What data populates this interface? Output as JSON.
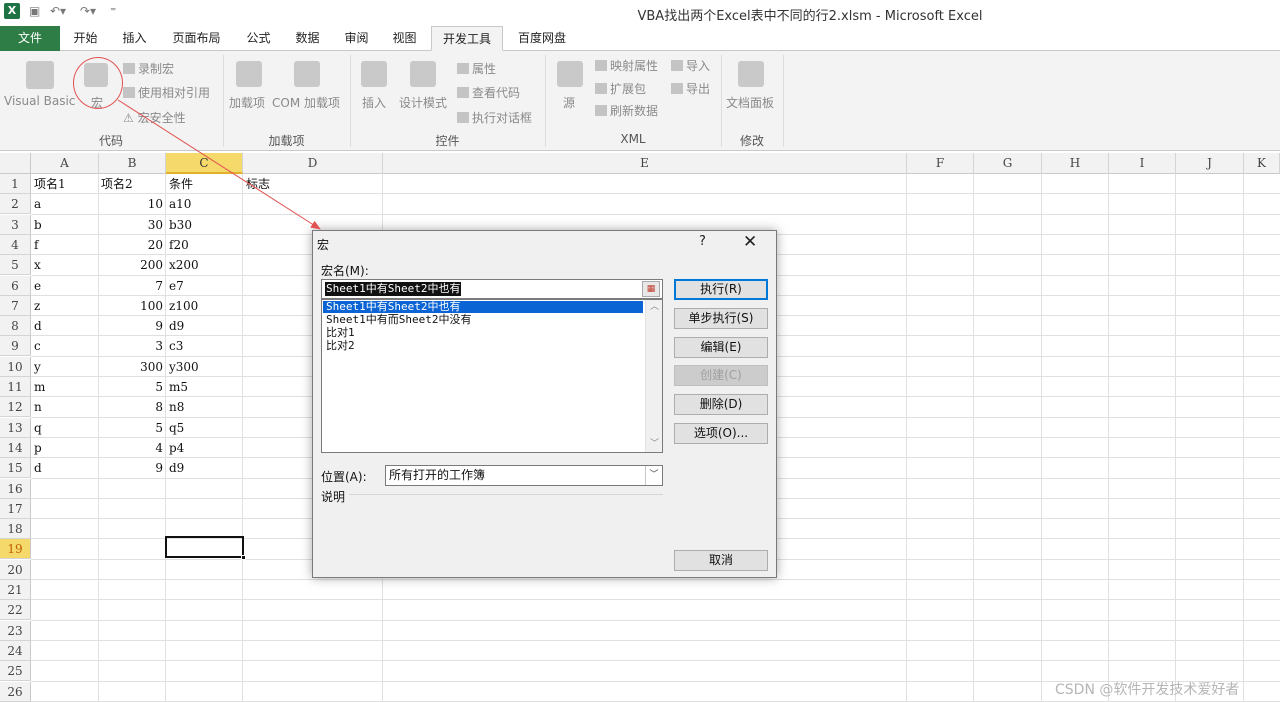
{
  "window": {
    "title": "VBA找出两个Excel表中不同的行2.xlsm - Microsoft Excel"
  },
  "ribbon": {
    "tabs": [
      "文件",
      "开始",
      "插入",
      "页面布局",
      "公式",
      "数据",
      "审阅",
      "视图",
      "开发工具",
      "百度网盘"
    ],
    "active_tab": "开发工具",
    "groups": {
      "code": {
        "label": "代码",
        "visual_basic": "Visual Basic",
        "macros": "宏",
        "record_macro": "录制宏",
        "use_relative": "使用相对引用",
        "macro_security": "宏安全性"
      },
      "addins": {
        "label": "加载项",
        "addins": "加载项",
        "com_addins": "COM 加载项"
      },
      "controls": {
        "label": "控件",
        "insert": "插入",
        "design_mode": "设计模式",
        "properties": "属性",
        "view_code": "查看代码",
        "run_dialog": "执行对话框"
      },
      "xml": {
        "label": "XML",
        "source": "源",
        "map_properties": "映射属性",
        "expansion_packs": "扩展包",
        "refresh_data": "刷新数据",
        "import": "导入",
        "export": "导出"
      },
      "modify": {
        "label": "修改",
        "document_panel": "文档面板"
      }
    }
  },
  "sheet": {
    "columns": [
      "A",
      "B",
      "C",
      "D",
      "E",
      "F",
      "G",
      "H",
      "I",
      "J",
      "K"
    ],
    "selected_column": "C",
    "row_numbers": [
      "1",
      "2",
      "3",
      "4",
      "5",
      "6",
      "7",
      "8",
      "9",
      "10",
      "11",
      "12",
      "13",
      "14",
      "15",
      "16",
      "17",
      "18",
      "19",
      "20",
      "21",
      "22",
      "23",
      "24",
      "25",
      "26"
    ],
    "selected_row": "19",
    "headers": [
      "项名1",
      "项名2",
      "条件",
      "标志"
    ],
    "rows": [
      [
        "a",
        "10",
        "a10"
      ],
      [
        "b",
        "30",
        "b30"
      ],
      [
        "f",
        "20",
        "f20"
      ],
      [
        "x",
        "200",
        "x200"
      ],
      [
        "e",
        "7",
        "e7"
      ],
      [
        "z",
        "100",
        "z100"
      ],
      [
        "d",
        "9",
        "d9"
      ],
      [
        "c",
        "3",
        "c3"
      ],
      [
        "y",
        "300",
        "y300"
      ],
      [
        "m",
        "5",
        "m5"
      ],
      [
        "n",
        "8",
        "n8"
      ],
      [
        "q",
        "5",
        "q5"
      ],
      [
        "p",
        "4",
        "p4"
      ],
      [
        "d",
        "9",
        "d9"
      ]
    ]
  },
  "dialog": {
    "title": "宏",
    "help": "?",
    "close": "✕",
    "macro_name_label": "宏名(M):",
    "macro_name_value": "Sheet1中有Sheet2中也有",
    "macros": [
      "Sheet1中有Sheet2中也有",
      "Sheet1中有而Sheet2中没有",
      "比对1",
      "比对2"
    ],
    "selected_macro_index": 0,
    "buttons": {
      "run": "执行(R)",
      "step_into": "单步执行(S)",
      "edit": "编辑(E)",
      "create": "创建(C)",
      "delete": "删除(D)",
      "options": "选项(O)...",
      "cancel": "取消"
    },
    "location_label": "位置(A):",
    "location_value": "所有打开的工作簿",
    "description_label": "说明"
  },
  "watermark": "CSDN @软件开发技术爱好者",
  "colors": {
    "file_tab": "#2f7d46",
    "selected_header": "#f5d96b",
    "list_selection": "#0a64d4",
    "annotation": "#e25252"
  }
}
